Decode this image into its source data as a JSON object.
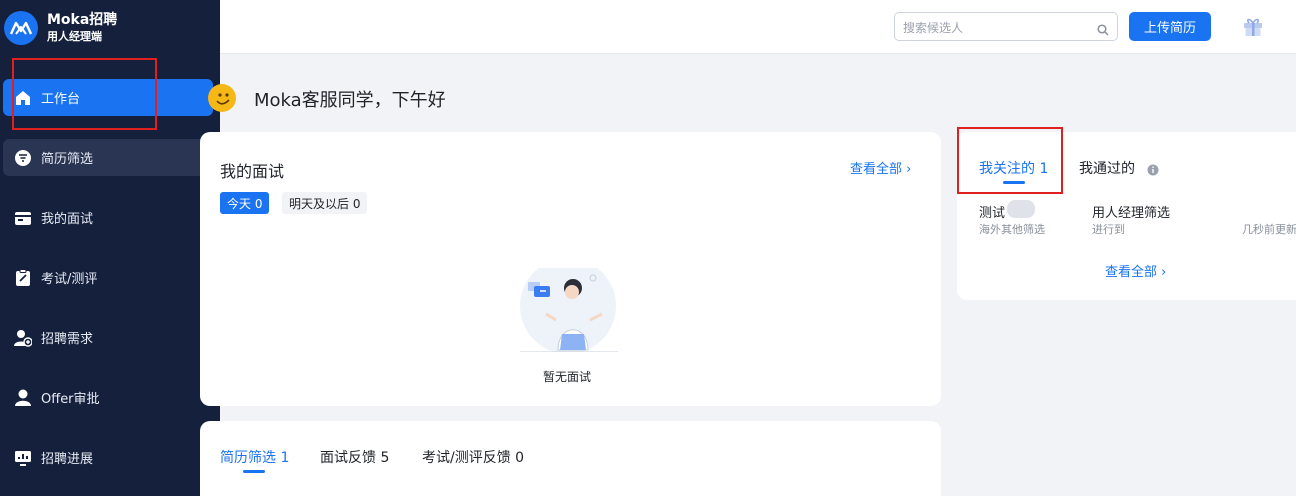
{
  "brand": {
    "name": "Moka招聘",
    "sub": "用人经理端"
  },
  "sidebar": {
    "items": [
      {
        "label": "工作台"
      },
      {
        "label": "简历筛选"
      },
      {
        "label": "我的面试"
      },
      {
        "label": "考试/测评"
      },
      {
        "label": "招聘需求"
      },
      {
        "label": "Offer审批"
      },
      {
        "label": "招聘进展"
      }
    ]
  },
  "header": {
    "search_placeholder": "搜索候选人",
    "upload_label": "上传简历"
  },
  "greeting": "Moka客服同学，下午好",
  "interviews": {
    "title": "我的面试",
    "view_all": "查看全部",
    "chips": [
      {
        "label": "今天 0"
      },
      {
        "label": "明天及以后 0"
      }
    ],
    "empty_text": "暂无面试"
  },
  "follow": {
    "tabs": [
      {
        "label": "我关注的 1"
      },
      {
        "label": "我通过的"
      }
    ],
    "row": {
      "name": "测试",
      "source": "海外其他筛选",
      "stage": "用人经理筛选",
      "status": "进行到",
      "time": "几秒前更新"
    },
    "view_all": "查看全部"
  },
  "tasks": {
    "tabs": [
      {
        "label": "简历筛选 1"
      },
      {
        "label": "面试反馈 5"
      },
      {
        "label": "考试/测评反馈 0"
      }
    ]
  },
  "colors": {
    "accent": "#1a73f1",
    "sidebar": "#15203c",
    "highlight": "#e02020"
  }
}
